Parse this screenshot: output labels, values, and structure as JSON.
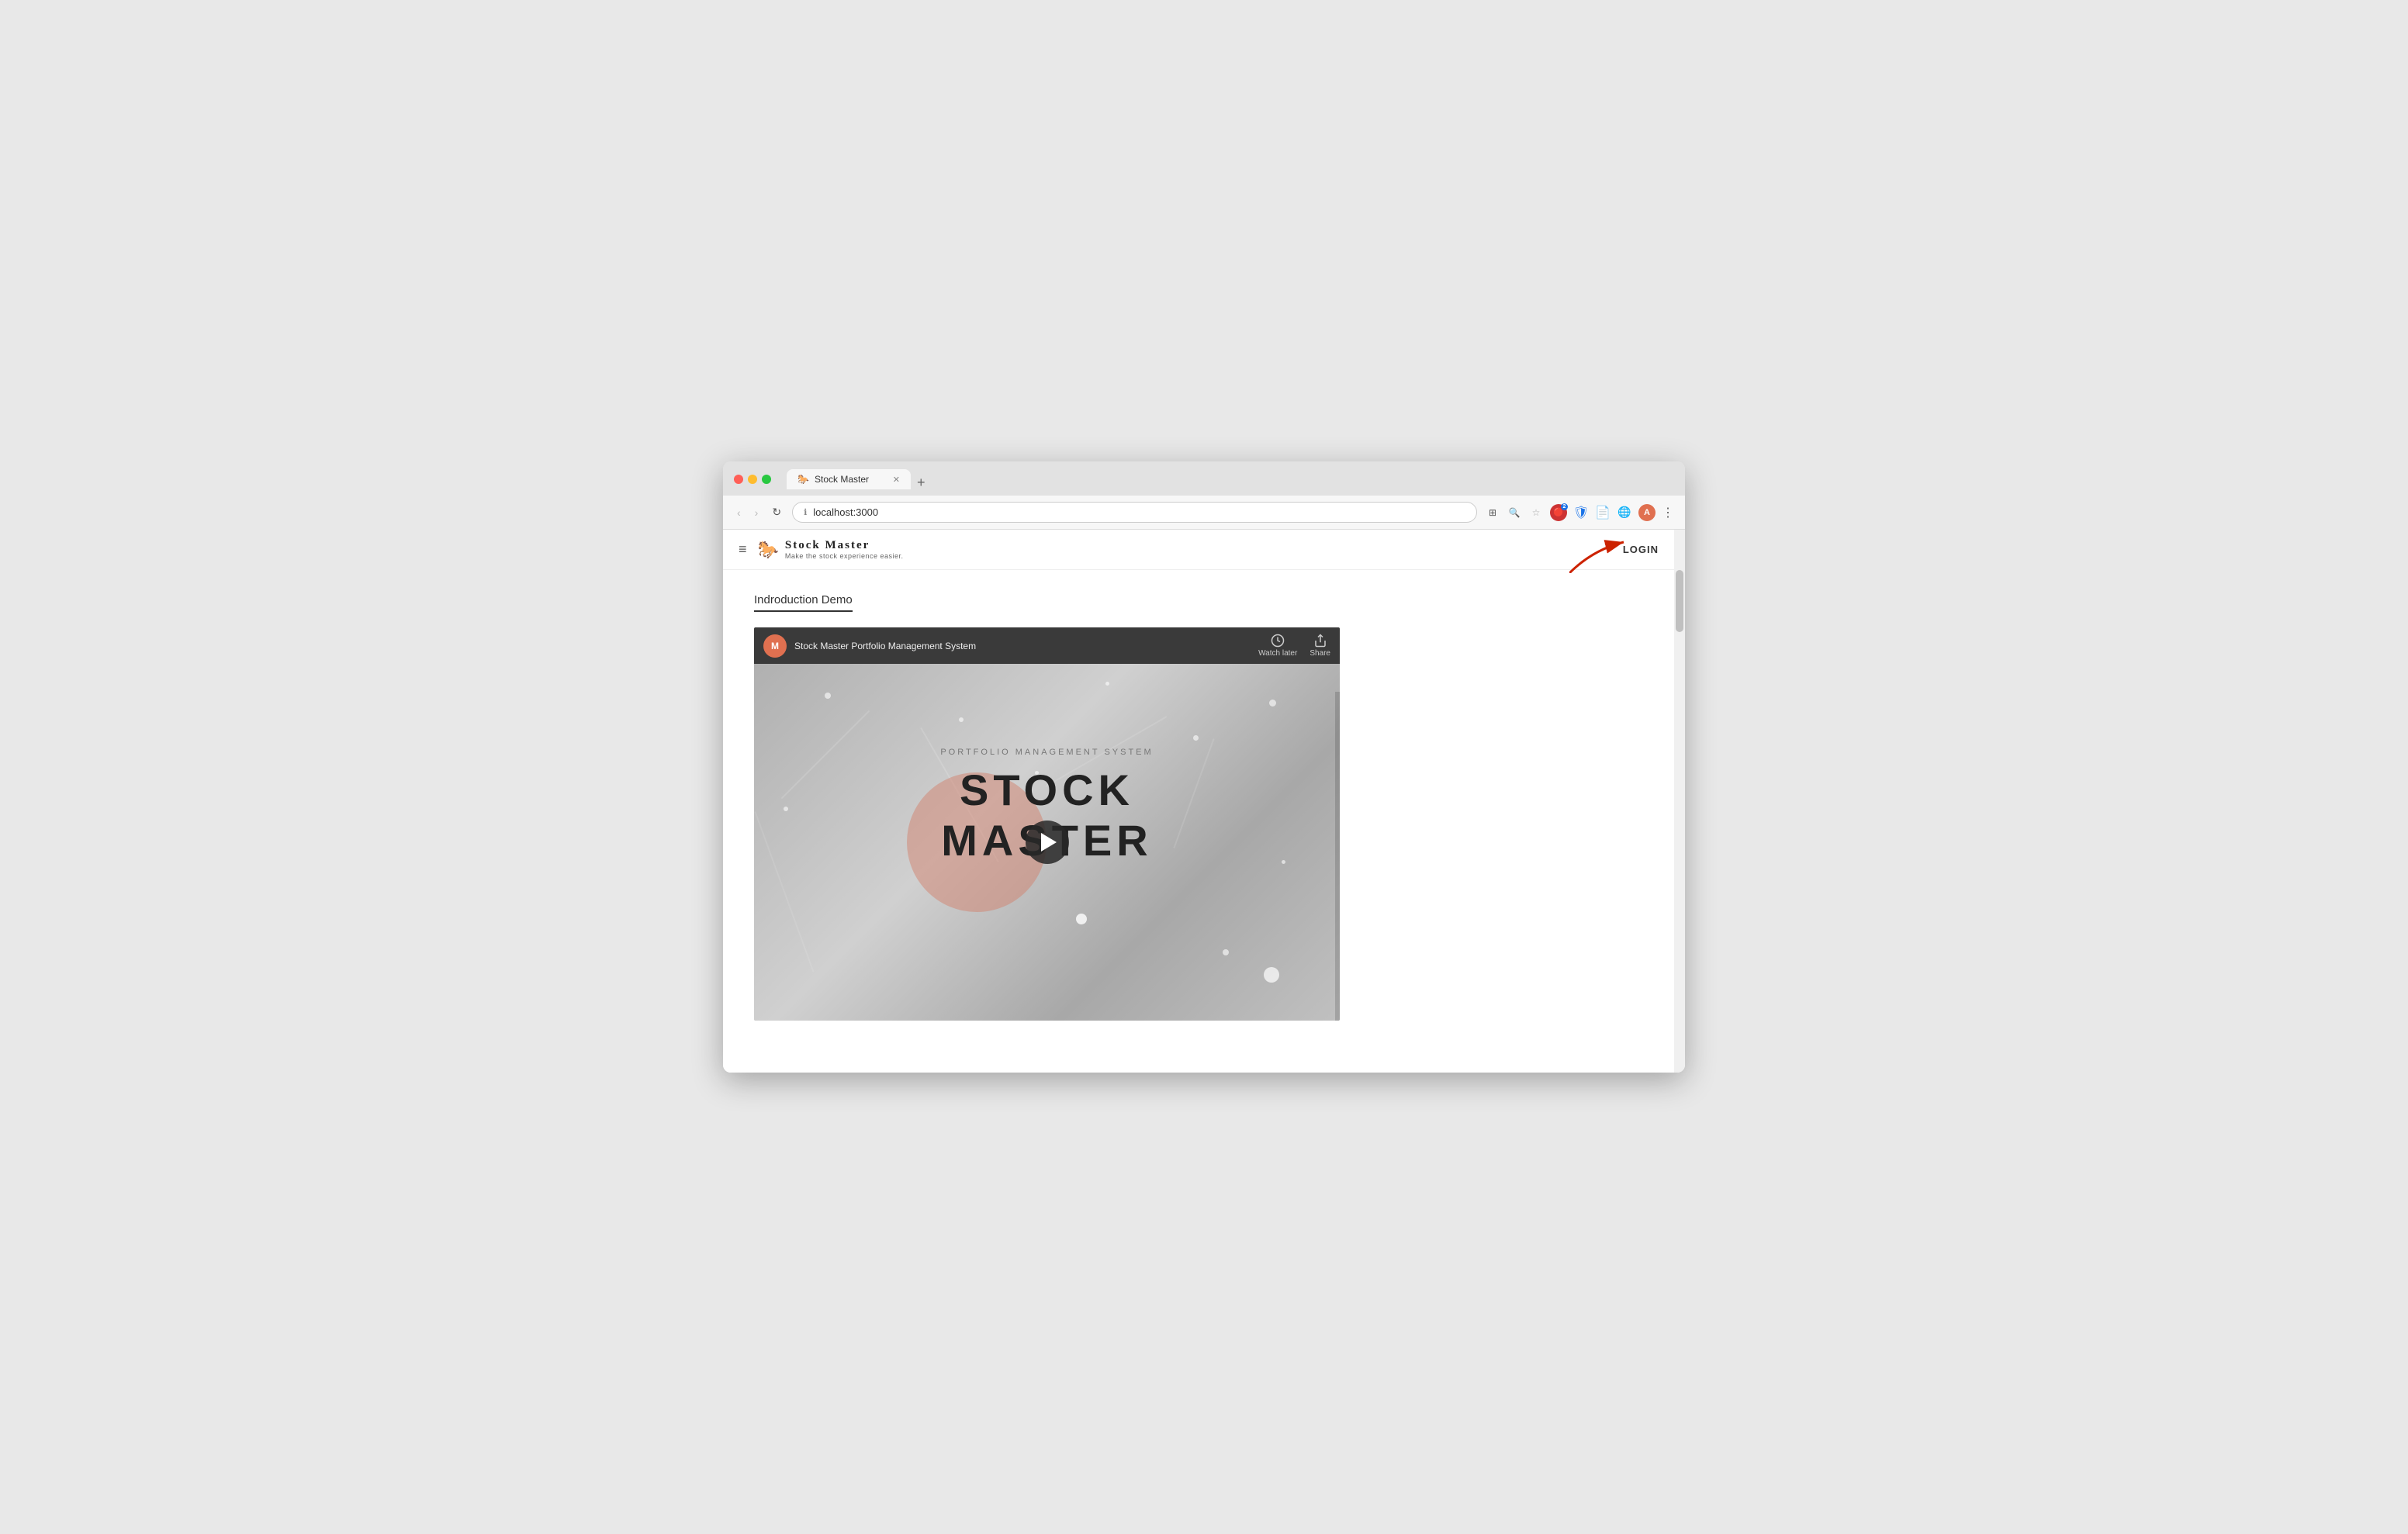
{
  "browser": {
    "url": "localhost:3000",
    "tab_title": "Stock Master",
    "tab_favicon": "🐎",
    "new_tab_label": "+",
    "nav": {
      "back_label": "‹",
      "forward_label": "›",
      "reload_label": "↻",
      "menu_label": "⋮"
    }
  },
  "header": {
    "hamburger_label": "≡",
    "logo_title": "Stock  Master",
    "logo_subtitle": "Make the stock experience easier.",
    "login_label": "LOGIN"
  },
  "main": {
    "section_title": "Indroduction Demo",
    "video": {
      "title": "Stock Master Portfolio Management System",
      "channel_initial": "M",
      "watch_later_label": "Watch later",
      "share_label": "Share",
      "portfolio_label": "PORTFOLIO MANAGEMENT SYSTEM",
      "brand_title": "STOCK MASTER"
    }
  }
}
